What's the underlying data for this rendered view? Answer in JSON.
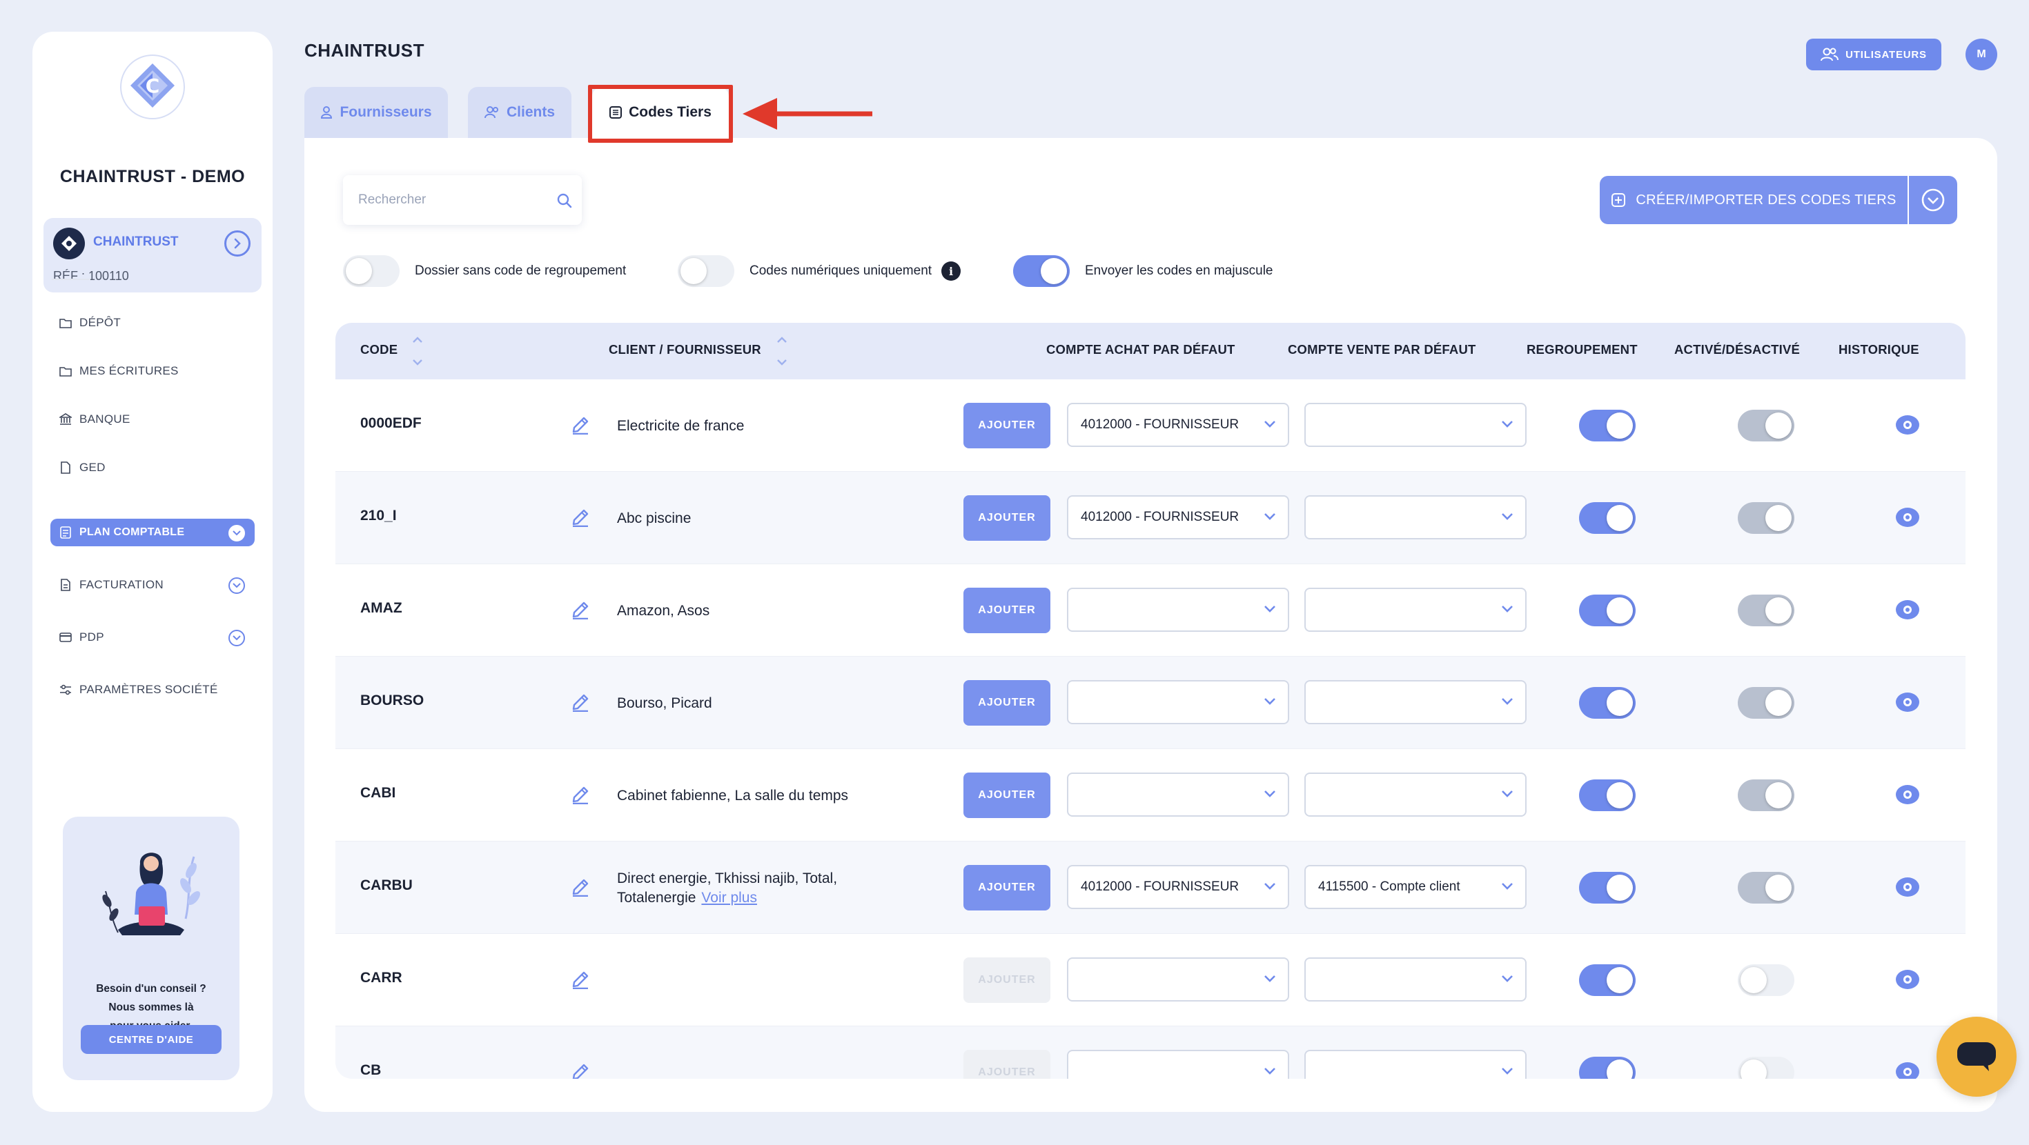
{
  "sidebar": {
    "company_name": "CHAINTRUST - DEMO",
    "org": {
      "name": "CHAINTRUST",
      "ref": "RÉF : 100110"
    },
    "nav": [
      {
        "label": "DÉPÔT",
        "icon": "folder-icon"
      },
      {
        "label": "MES ÉCRITURES",
        "icon": "folder-icon"
      },
      {
        "label": "BANQUE",
        "icon": "bank-icon"
      },
      {
        "label": "GED",
        "icon": "document-icon"
      },
      {
        "label": "PLAN COMPTABLE",
        "icon": "list-icon",
        "active": true
      },
      {
        "label": "FACTURATION",
        "icon": "invoice-icon"
      },
      {
        "label": "PDP",
        "icon": "card-icon"
      },
      {
        "label": "PARAMÈTRES SOCIÉTÉ",
        "icon": "sliders-icon"
      }
    ],
    "help": {
      "line1": "Besoin d'un conseil ?",
      "line2": "Nous sommes là",
      "line3": "pour vous aider.",
      "button": "CENTRE D'AIDE"
    }
  },
  "header": {
    "title": "CHAINTRUST",
    "users_button": "UTILISATEURS",
    "avatar_initial": "M"
  },
  "tabs": [
    {
      "label": "Fournisseurs",
      "active": false
    },
    {
      "label": "Clients",
      "active": false
    },
    {
      "label": "Codes Tiers",
      "active": true
    }
  ],
  "toolbar": {
    "search_placeholder": "Rechercher",
    "create_button": "CRÉER/IMPORTER DES CODES TIERS"
  },
  "toggles": [
    {
      "label": "Dossier sans code de regroupement",
      "on": false
    },
    {
      "label": "Codes numériques uniquement",
      "on": false,
      "info": "i"
    },
    {
      "label": "Envoyer les codes en majuscule",
      "on": true
    }
  ],
  "table": {
    "headers": {
      "code": "CODE",
      "client": "CLIENT / FOURNISSEUR",
      "achat": "COMPTE ACHAT PAR DÉFAUT",
      "vente": "COMPTE VENTE PAR DÉFAUT",
      "regroupement": "REGROUPEMENT",
      "active": "ACTIVÉ/DÉSACTIVÉ",
      "historique": "HISTORIQUE"
    },
    "add_label": "AJOUTER",
    "see_more": "Voir plus",
    "rows": [
      {
        "code": "0000EDF",
        "name": "Electricite de france",
        "achat": "4012000 - FOURNISSEUR",
        "vente": "",
        "add_enabled": true,
        "regroupement": true,
        "active": "grey"
      },
      {
        "code": "210_I",
        "name": "Abc piscine",
        "achat": "4012000 - FOURNISSEUR",
        "vente": "",
        "add_enabled": true,
        "regroupement": true,
        "active": "grey"
      },
      {
        "code": "AMAZ",
        "name": "Amazon, Asos",
        "achat": "",
        "vente": "",
        "add_enabled": true,
        "regroupement": true,
        "active": "grey"
      },
      {
        "code": "BOURSO",
        "name": "Bourso, Picard",
        "achat": "",
        "vente": "",
        "add_enabled": true,
        "regroupement": true,
        "active": "grey"
      },
      {
        "code": "CABI",
        "name": "Cabinet fabienne, La salle du temps",
        "achat": "",
        "vente": "",
        "add_enabled": true,
        "regroupement": true,
        "active": "grey"
      },
      {
        "code": "CARBU",
        "name": "Direct energie, Tkhissi najib, Total,",
        "name2": "Totalenergie",
        "achat": "4012000 - FOURNISSEUR",
        "vente": "4115500 - Compte client",
        "add_enabled": true,
        "regroupement": true,
        "active": "grey"
      },
      {
        "code": "CARR",
        "name": "",
        "achat": "",
        "vente": "",
        "add_enabled": false,
        "regroupement": true,
        "active": "off"
      },
      {
        "code": "CB",
        "name": "",
        "achat": "",
        "vente": "",
        "add_enabled": false,
        "regroupement": true,
        "active": "off"
      }
    ]
  },
  "colors": {
    "accent": "#6f8aec",
    "highlight_red": "#e0392b",
    "chat": "#f2b43c"
  }
}
